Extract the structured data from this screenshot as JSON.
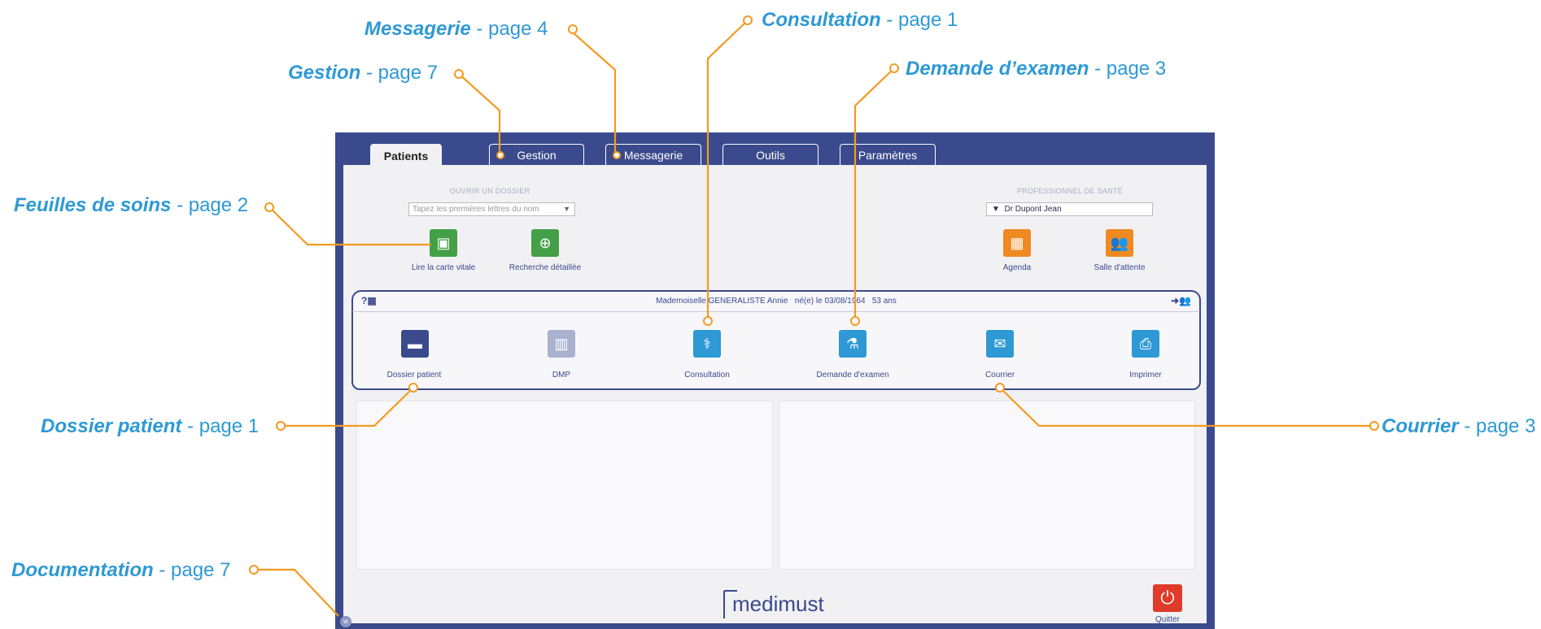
{
  "callouts": {
    "messagerie": {
      "title": "Messagerie",
      "page": " - page 4"
    },
    "consultation": {
      "title": "Consultation",
      "page": " - page 1"
    },
    "gestion": {
      "title": "Gestion",
      "page": " - page 7"
    },
    "demande": {
      "title": "Demande d’examen",
      "page": " - page 3"
    },
    "feuilles": {
      "title": "Feuilles de soins",
      "page": " - page 2"
    },
    "dossier": {
      "title": "Dossier patient",
      "page": " - page 1"
    },
    "courrier": {
      "title": "Courrier",
      "page": " - page 3"
    },
    "documentation": {
      "title": "Documentation",
      "page": " - page 7"
    }
  },
  "tabs": [
    "Patients",
    "Gestion",
    "Messagerie",
    "Outils",
    "Paramètres"
  ],
  "open_file": {
    "heading": "OUVRIR UN DOSSIER",
    "placeholder": "Tapez les premières lettres du nom",
    "read_card": "Lire la carte vitale",
    "search": "Recherche détaillée"
  },
  "professional": {
    "heading": "PROFESSIONNEL DE SANTE",
    "selected": "Dr Dupont Jean",
    "agenda": "Agenda",
    "waiting_room": "Salle d'attente"
  },
  "patient": {
    "name": "Mademoiselle GENERALISTE Annie",
    "dob": "né(e) le 03/08/1964",
    "age": "53 ans"
  },
  "actions": [
    "Dossier patient",
    "DMP",
    "Consultation",
    "Demande d'examen",
    "Courrier",
    "Imprimer"
  ],
  "brand": "medimust",
  "quit": "Quitter",
  "colors": {
    "accent": "#2e99d4",
    "leader": "#f39a1f",
    "frame": "#3a4a8c"
  }
}
